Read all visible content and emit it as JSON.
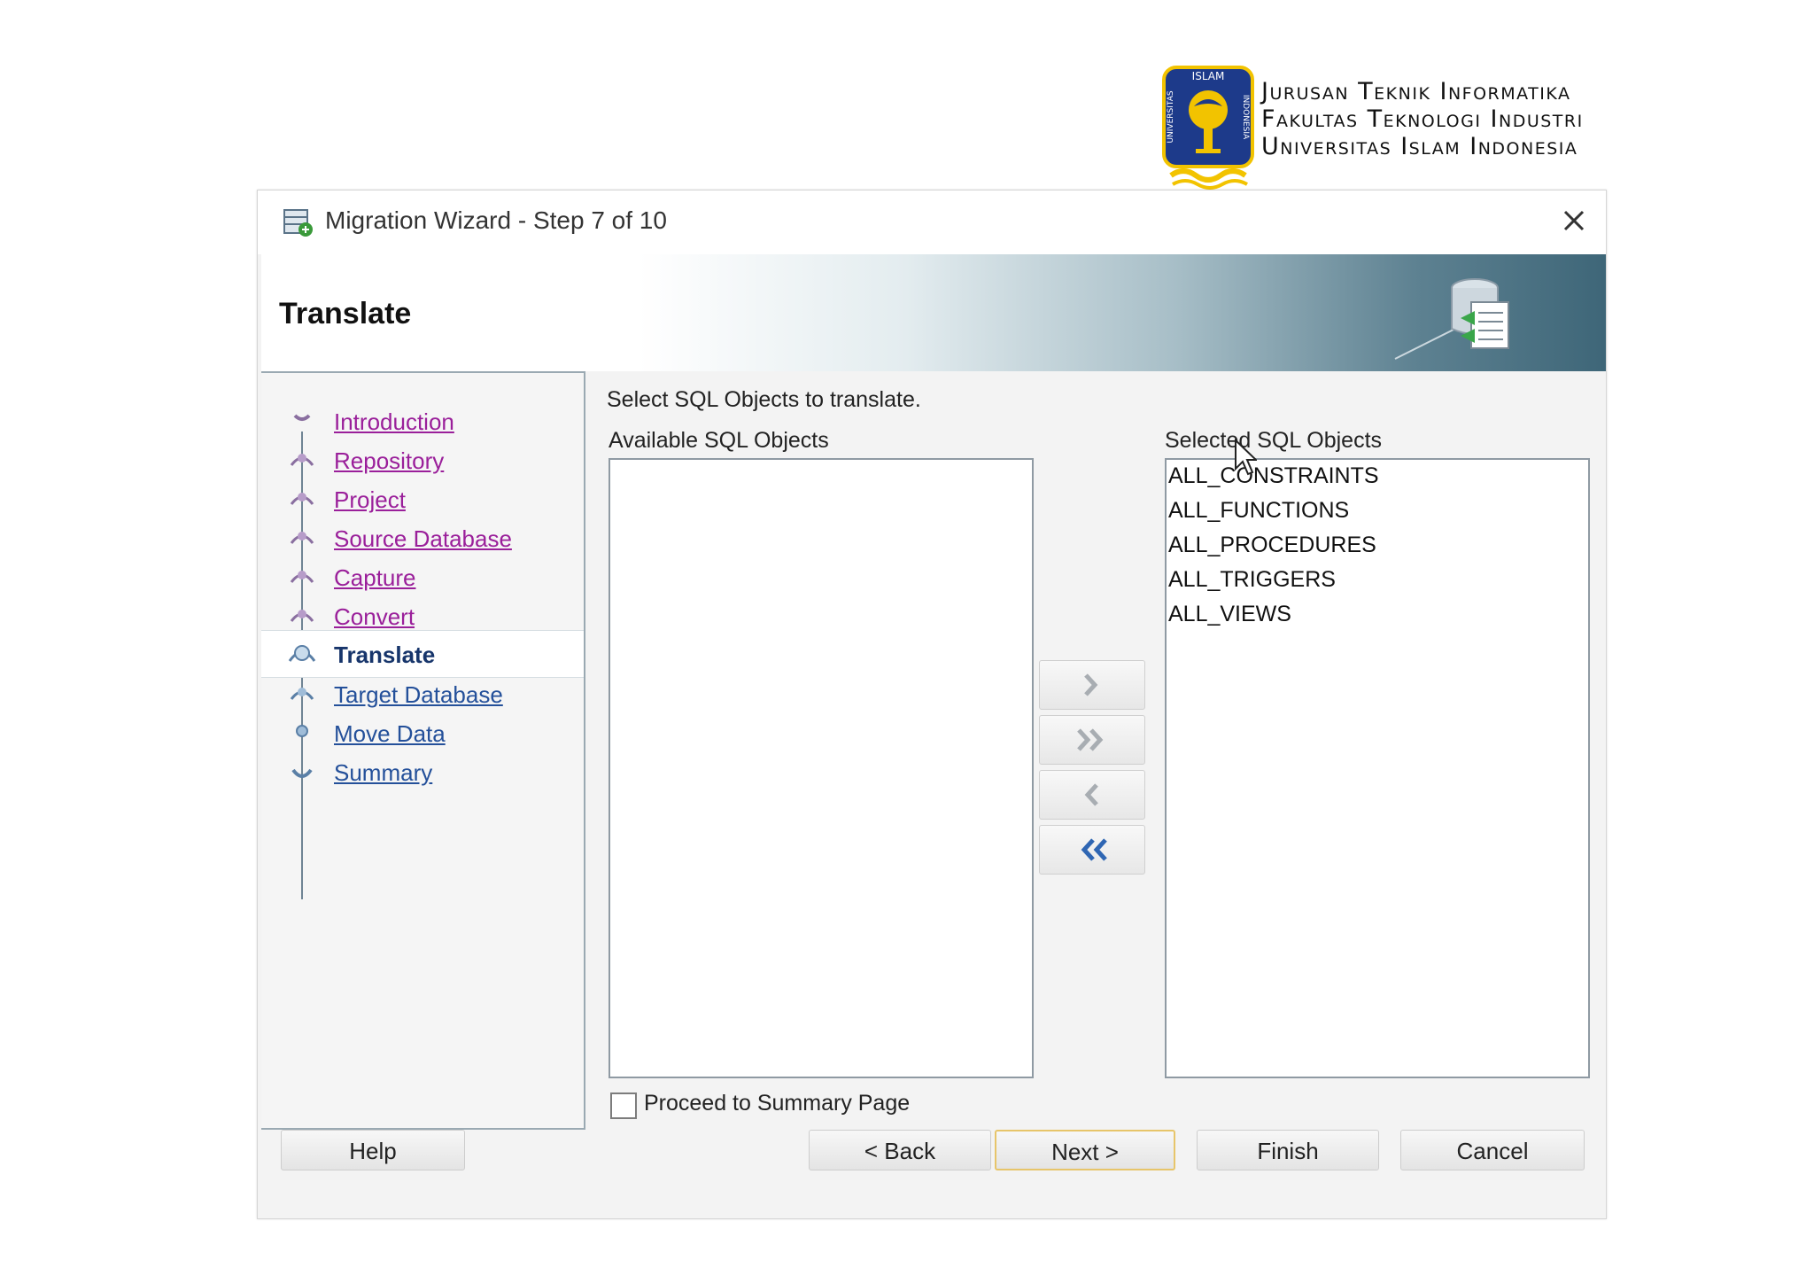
{
  "institution": {
    "seal_text": "ISLAM",
    "seal_text_left": "UNIVERSITAS",
    "seal_text_right": "INDONESIA",
    "lines": [
      "Jurusan Teknik Informatika",
      "Fakultas Teknologi Industri",
      "Universitas Islam Indonesia"
    ]
  },
  "dialog": {
    "title": "Migration Wizard - Step 7 of 10",
    "page_heading": "Translate",
    "instruction": "Select SQL Objects to translate.",
    "available_label": "Available SQL Objects",
    "selected_label": "Selected SQL Objects",
    "available_items": [],
    "selected_items": [
      "ALL_CONSTRAINTS",
      "ALL_FUNCTIONS",
      "ALL_PROCEDURES",
      "ALL_TRIGGERS",
      "ALL_VIEWS"
    ],
    "proceed_label": "Proceed to Summary Page",
    "proceed_checked": false
  },
  "steps": [
    {
      "label": "Introduction",
      "state": "visited"
    },
    {
      "label": "Repository",
      "state": "visited"
    },
    {
      "label": "Project",
      "state": "visited"
    },
    {
      "label": "Source Database",
      "state": "visited"
    },
    {
      "label": "Capture",
      "state": "visited"
    },
    {
      "label": "Convert",
      "state": "visited"
    },
    {
      "label": "Translate",
      "state": "current"
    },
    {
      "label": "Target Database",
      "state": "upcoming"
    },
    {
      "label": "Move Data",
      "state": "upcoming"
    },
    {
      "label": "Summary",
      "state": "upcoming"
    }
  ],
  "buttons": {
    "help": "Help",
    "back": "< Back",
    "next": "Next >",
    "finish": "Finish",
    "cancel": "Cancel"
  },
  "colors": {
    "visited_link": "#9a1f9a",
    "upcoming_link": "#24509a",
    "current_step": "#17356b",
    "seal_blue": "#1d3a8a",
    "seal_gold": "#f2c300"
  }
}
